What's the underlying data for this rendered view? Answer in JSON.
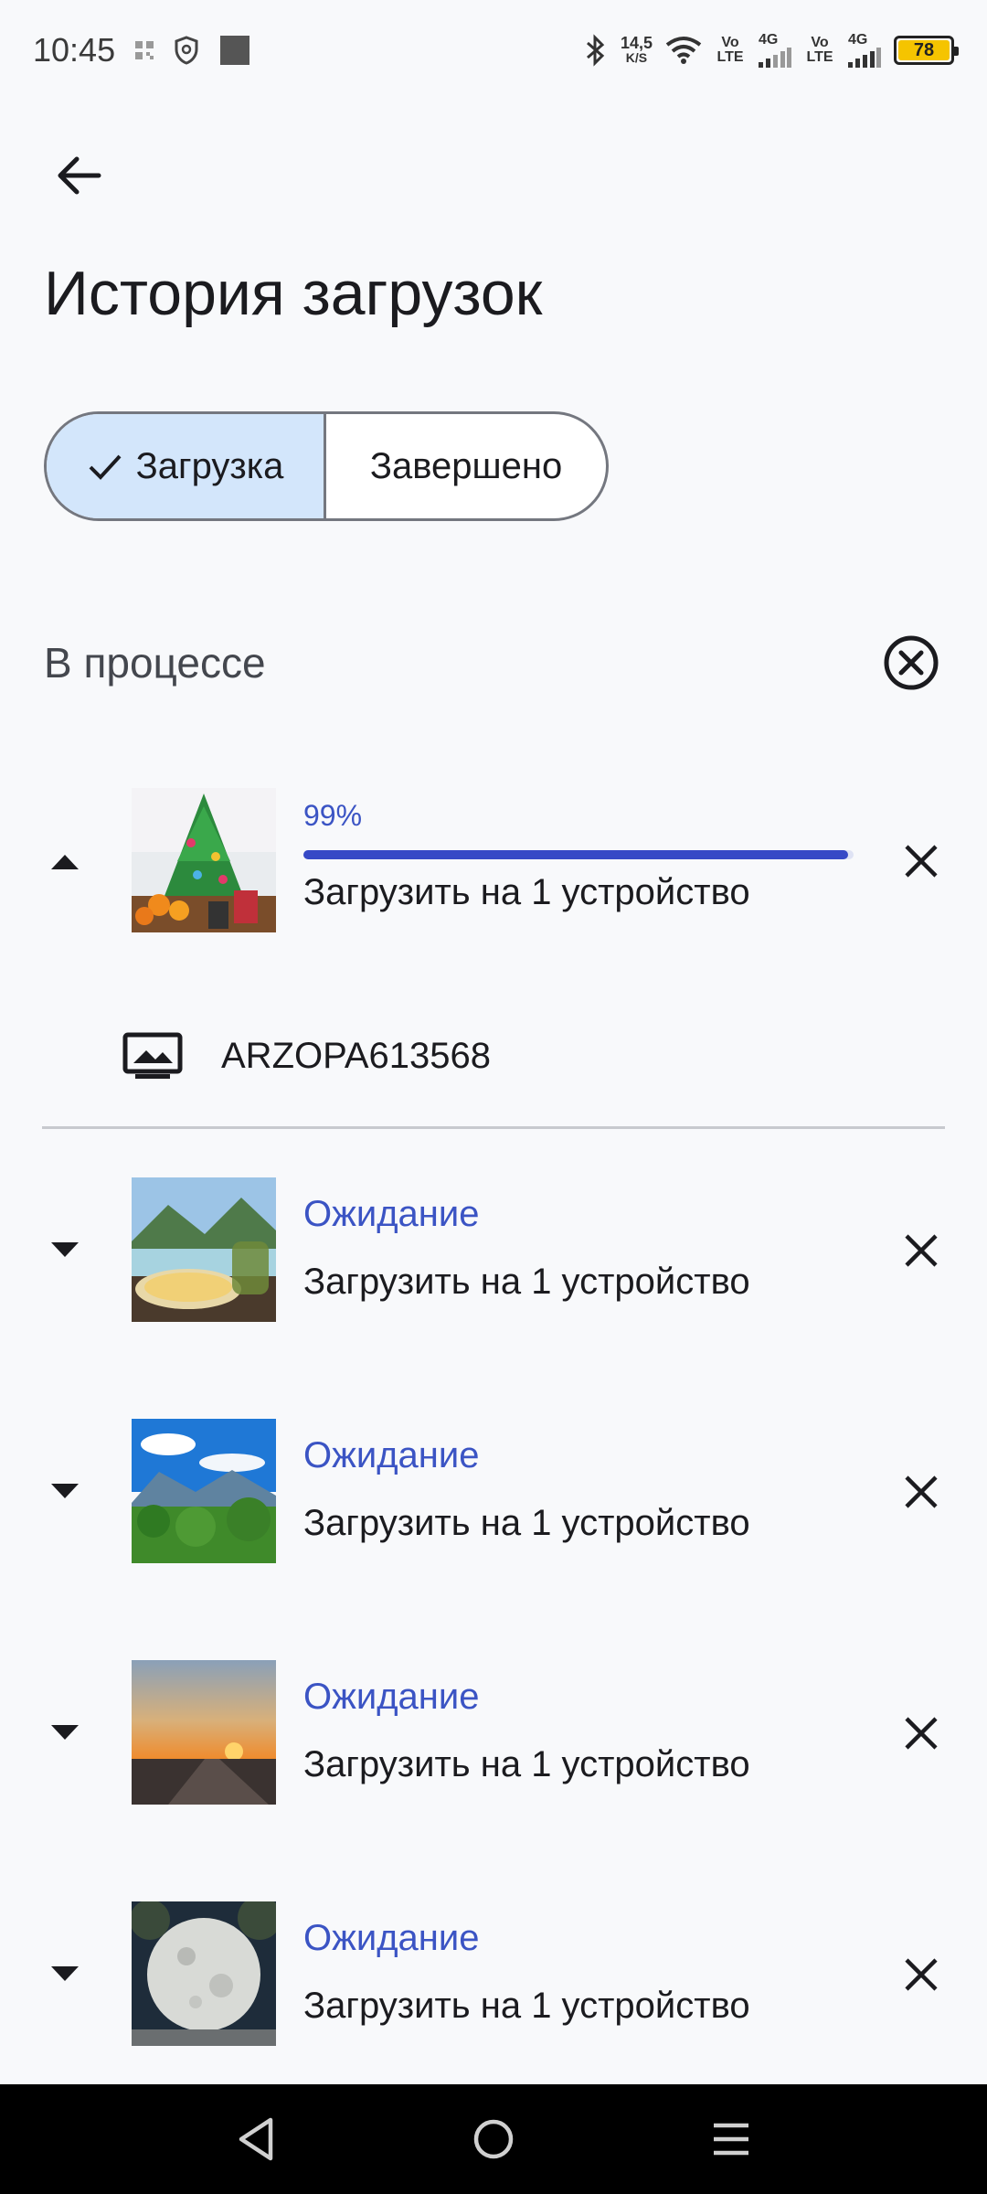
{
  "status_bar": {
    "time": "10:45",
    "net_speed_value": "14,5",
    "net_speed_unit": "K/S",
    "volte1": "Vo LTE",
    "lte1": "4G",
    "volte2": "Vo LTE",
    "lte2": "4G",
    "battery_level": "78",
    "colors": {
      "battery": "#f5c400"
    }
  },
  "header": {
    "title": "История загрузок"
  },
  "tabs": [
    {
      "label": "Загрузка",
      "selected": true
    },
    {
      "label": "Завершено",
      "selected": false
    }
  ],
  "section": {
    "title": "В процессе"
  },
  "uploads": [
    {
      "status": "99%",
      "progress": 0.99,
      "description": "Загрузить на 1 устройство",
      "expanded": true,
      "thumbnail": "christmas-tree",
      "device": "ARZOPA613568"
    },
    {
      "status": "Ожидание",
      "description": "Загрузить на 1 устройство",
      "expanded": false,
      "thumbnail": "mountain-lake-food"
    },
    {
      "status": "Ожидание",
      "description": "Загрузить на 1 устройство",
      "expanded": false,
      "thumbnail": "mountain-forest"
    },
    {
      "status": "Ожидание",
      "description": "Загрузить на 1 устройство",
      "expanded": false,
      "thumbnail": "sunset-road"
    },
    {
      "status": "Ожидание",
      "description": "Загрузить на 1 устройство",
      "expanded": false,
      "thumbnail": "moon-sculpture"
    }
  ],
  "colors": {
    "accent": "#3b54c4",
    "selected_tab": "#d3e6fb"
  }
}
